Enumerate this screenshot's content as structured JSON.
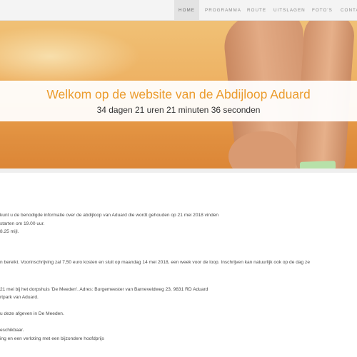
{
  "nav": {
    "items": [
      {
        "label": "HOME",
        "active": true
      },
      {
        "label": "PROGRAMMA",
        "active": false
      },
      {
        "label": "ROUTE",
        "active": false
      },
      {
        "label": "UITSLAGEN",
        "active": false
      },
      {
        "label": "FOTO'S",
        "active": false
      },
      {
        "label": "CONTA",
        "active": false
      }
    ]
  },
  "hero": {
    "title": "Welkom op de website van de Abdijloop Aduard",
    "countdown": "34 dagen 21 uren 21 minuten 36 seconden"
  },
  "content": {
    "lines": [
      "kunt u de benodigde informatie over de abdijloop van Aduard die wordt gehouden op 21 mei 2018 vinden",
      "starten om 19.00 uur.",
      "8.25 mijl.",
      "n bereikt. Voorinschrijving zal 7,50 euro kosten en sluit op maandag 14 mei 2018, een week voor de loop. Inschrijven kan natuurlijk ook op de dag ze",
      "21 mei bij het dorpshuis 'De Meeden'. Adres: Burgemeester van Barneveldweg 23, 9831 RD Aduard",
      "rtpark van Aduard.",
      "u deze afgeven in De Meeden.",
      "eschikbaar.",
      "ing en een verloting met een bijzondere hoofdprijs"
    ]
  },
  "colors": {
    "accent": "#eb9b2c",
    "nav_bg": "#f4f4f4",
    "nav_active_bg": "#e3e3e3"
  }
}
